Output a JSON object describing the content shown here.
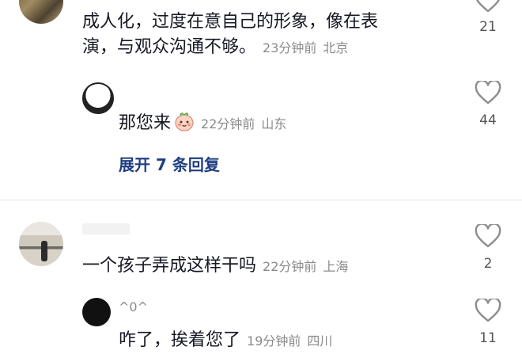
{
  "comments": [
    {
      "text_line1": "成人化，过度在意自己的形象，像在表",
      "text_line2": "演，与观众沟通不够。",
      "time": "23分钟前",
      "location": "北京",
      "likes": "21",
      "replies": [
        {
          "text": "那您来",
          "emoji": "peach-face-emoji",
          "time": "22分钟前",
          "location": "山东",
          "likes": "44"
        }
      ],
      "expand_label": "展开 7 条回复"
    },
    {
      "text": "一个孩子弄成这样干吗",
      "time": "22分钟前",
      "location": "上海",
      "likes": "2",
      "replies": [
        {
          "username": "^0^",
          "text": "咋了，挨着您了",
          "time": "19分钟前",
          "location": "四川",
          "likes": "11"
        }
      ]
    }
  ],
  "colors": {
    "text": "#161823",
    "meta": "#8a8a8a",
    "expand": "#1f3f80",
    "heart_outline": "#8c8c8c"
  }
}
